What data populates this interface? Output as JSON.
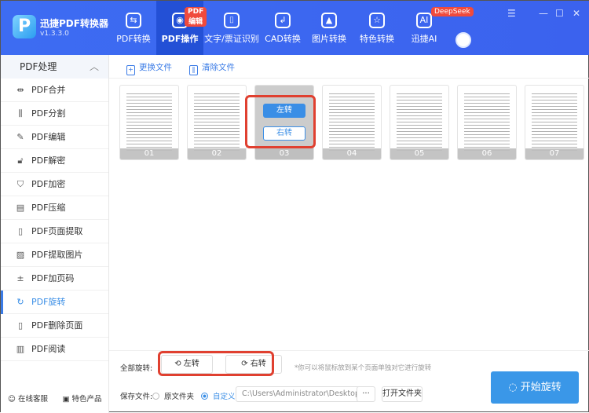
{
  "app": {
    "name": "迅捷PDF转换器",
    "version": "v1.3.3.0"
  },
  "nav": [
    {
      "label": "PDF转换",
      "icon": "convert-icon"
    },
    {
      "label": "PDF操作",
      "icon": "pdf-operate-icon",
      "badge": "PDF编辑",
      "active": true
    },
    {
      "label": "文字/票证识别",
      "icon": "ocr-icon"
    },
    {
      "label": "CAD转换",
      "icon": "cad-icon"
    },
    {
      "label": "图片转换",
      "icon": "image-icon"
    },
    {
      "label": "特色转换",
      "icon": "special-icon"
    },
    {
      "label": "迅捷AI",
      "icon": "ai-icon",
      "badge": "DeepSeek"
    }
  ],
  "sidebar": {
    "header": "PDF处理",
    "items": [
      {
        "label": "PDF合并",
        "icon": "merge-icon"
      },
      {
        "label": "PDF分割",
        "icon": "split-icon"
      },
      {
        "label": "PDF编辑",
        "icon": "edit-icon"
      },
      {
        "label": "PDF解密",
        "icon": "unlock-icon"
      },
      {
        "label": "PDF加密",
        "icon": "shield-icon"
      },
      {
        "label": "PDF压缩",
        "icon": "compress-icon"
      },
      {
        "label": "PDF页面提取",
        "icon": "extract-page-icon"
      },
      {
        "label": "PDF提取图片",
        "icon": "extract-image-icon"
      },
      {
        "label": "PDF加页码",
        "icon": "page-number-icon"
      },
      {
        "label": "PDF旋转",
        "icon": "rotate-icon",
        "active": true
      },
      {
        "label": "PDF删除页面",
        "icon": "delete-page-icon"
      },
      {
        "label": "PDF阅读",
        "icon": "read-icon"
      }
    ],
    "bottom": [
      "在线客服",
      "特色产品"
    ]
  },
  "toolbar": {
    "replace": "更换文件",
    "clear": "清除文件"
  },
  "pages": [
    "01",
    "02",
    "03",
    "04",
    "05",
    "06",
    "07"
  ],
  "hover_page": {
    "rotate_left": "左转",
    "rotate_right": "右转"
  },
  "bottom": {
    "rotate_all_label": "全部旋转:",
    "left": "左转",
    "right": "右转",
    "hint": "*你可以将鼠标放到某个页面单独对它进行旋转",
    "save_label": "保存文件:",
    "opt_original": "原文件夹",
    "opt_custom": "自定义",
    "path": "C:\\Users\\Administrator\\Desktop",
    "browse": "···",
    "open_folder": "打开文件夹",
    "start": "开始旋转"
  },
  "colors": {
    "titlebar": "#3d6cf2",
    "accent": "#3a8ee6",
    "highlight": "#e04030"
  }
}
